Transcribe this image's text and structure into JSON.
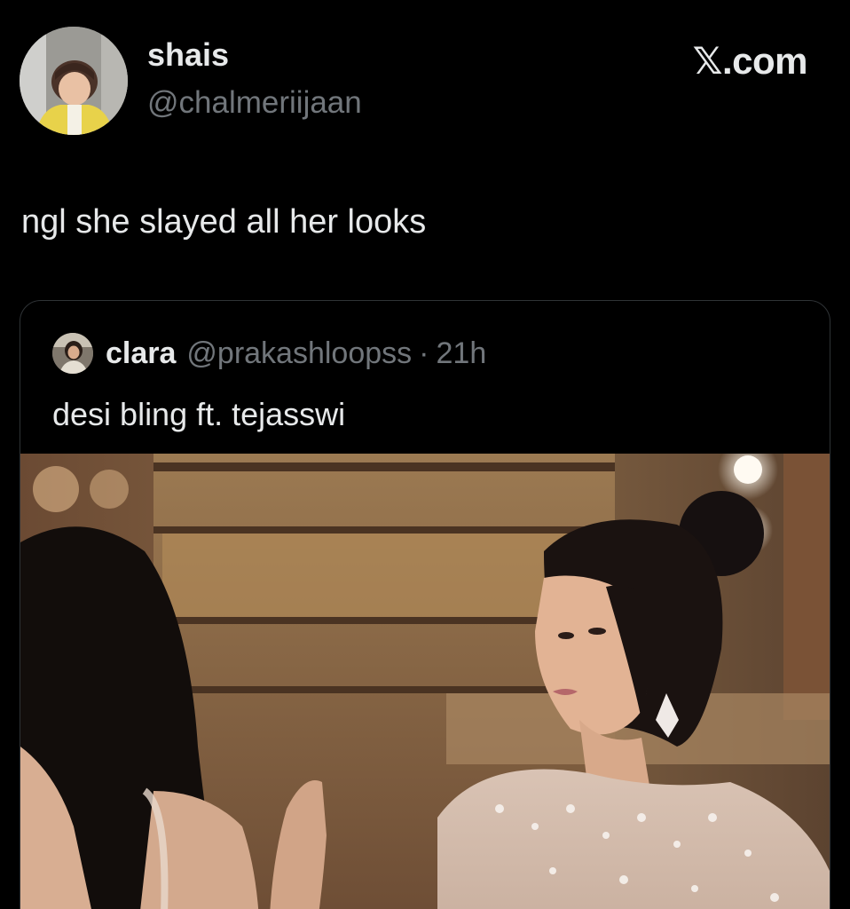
{
  "author": {
    "display_name": "shais",
    "handle": "@chalmeriijaan",
    "avatar_icon": "child-avatar"
  },
  "brand": "𝕏.com",
  "tweet": {
    "text": "ngl she slayed all her looks"
  },
  "quoted_tweet": {
    "display_name": "clara",
    "handle": "@prakashloopss",
    "separator": "·",
    "time": "21h",
    "text": "desi bling ft. tejasswi",
    "avatar_icon": "woman-avatar",
    "media_icon": "photo-two-women"
  },
  "colors": {
    "background": "#000000",
    "primary_text": "#e7e9ea",
    "secondary_text": "#71767b",
    "border": "#2f3336"
  }
}
